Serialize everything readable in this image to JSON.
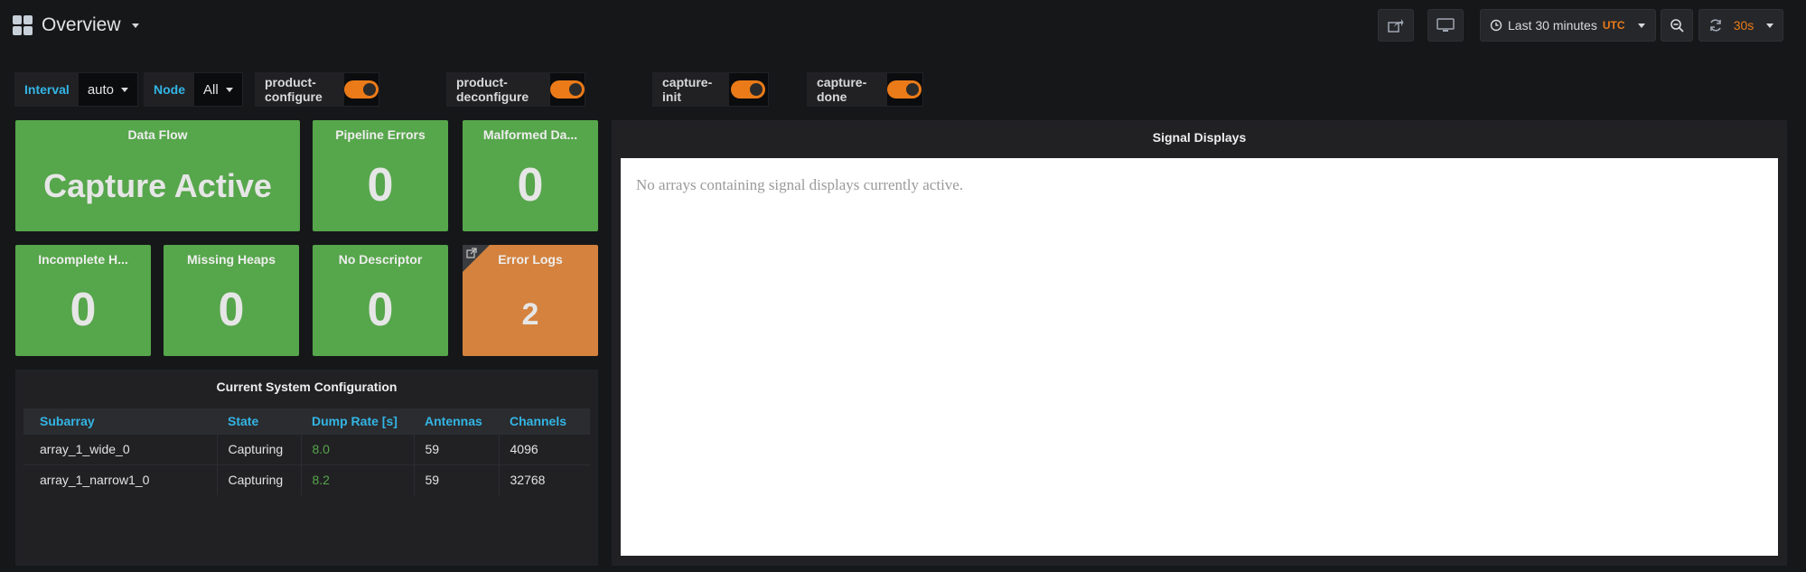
{
  "navbar": {
    "title": "Overview",
    "icons": {
      "dashboard": "dashboard-grid-icon",
      "share": "share-icon",
      "tv": "tv-mode-icon",
      "clock": "clock-icon",
      "zoom": "zoom-out-icon",
      "refresh": "refresh-icon"
    },
    "time_range": "Last 30 minutes",
    "timezone": "UTC",
    "refresh_interval": "30s"
  },
  "variables": {
    "interval": {
      "label": "Interval",
      "value": "auto"
    },
    "node": {
      "label": "Node",
      "value": "All"
    },
    "toggles": [
      {
        "label": "product-configure",
        "on": true
      },
      {
        "label": "product-deconfigure",
        "on": true
      },
      {
        "label": "capture-init",
        "on": true
      },
      {
        "label": "capture-done",
        "on": true
      }
    ]
  },
  "panels": {
    "data_flow": {
      "title": "Data Flow",
      "value": "Capture Active"
    },
    "pipeline_errors": {
      "title": "Pipeline Errors",
      "value": "0"
    },
    "malformed": {
      "title": "Malformed Da...",
      "value": "0"
    },
    "incomplete": {
      "title": "Incomplete H...",
      "value": "0"
    },
    "missing_heaps": {
      "title": "Missing Heaps",
      "value": "0"
    },
    "no_descriptor": {
      "title": "No Descriptor",
      "value": "0"
    },
    "error_logs": {
      "title": "Error Logs",
      "value": "2",
      "link_icon": "external-link-icon"
    }
  },
  "config": {
    "title": "Current System Configuration",
    "columns": [
      "Subarray",
      "State",
      "Dump Rate [s]",
      "Antennas",
      "Channels"
    ],
    "rows": [
      [
        "array_1_wide_0",
        "Capturing",
        "8.0",
        "59",
        "4096"
      ],
      [
        "array_1_narrow1_0",
        "Capturing",
        "8.2",
        "59",
        "32768"
      ]
    ]
  },
  "signal": {
    "title": "Signal Displays",
    "message": "No arrays containing signal displays currently active."
  },
  "colors": {
    "ok": "#56a64b",
    "warn": "#d4823e",
    "accent": "#33b5e5",
    "orange": "#eb7b18"
  }
}
